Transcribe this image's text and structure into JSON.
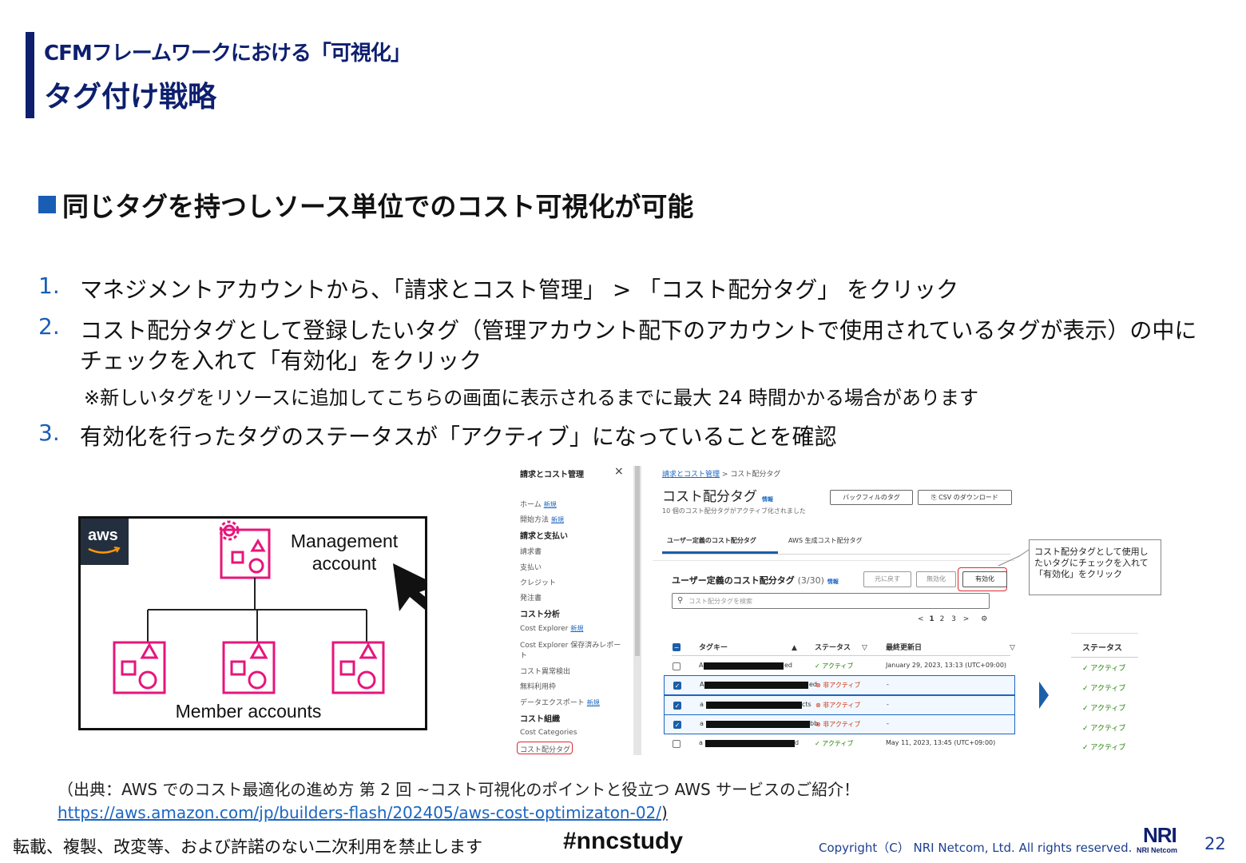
{
  "header": {
    "subtitle": "CFMフレームワークにおける「可視化」",
    "title": "タグ付け戦略"
  },
  "section": {
    "heading": "同じタグを持つしソース単位でのコスト可視化が可能"
  },
  "steps": [
    {
      "num": "1.",
      "line1": "マネジメントアカウントから、「請求とコスト管理」 > 「コスト配分タグ」 をクリック",
      "line2": ""
    },
    {
      "num": "2.",
      "line1": "コスト配分タグとして登録したいタグ（管理アカウント配下のアカウントで使用されているタグが表示）の中に",
      "line2": "チェックを入れて「有効化」をクリック"
    },
    {
      "num": "3.",
      "line1": "有効化を行ったタグのステータスが「アクティブ」になっていることを確認",
      "line2": ""
    }
  ],
  "note": "※新しいタグをリソースに追加してこちらの画面に表示されるまでに最大 24 時間かかる場合があります",
  "diagram": {
    "logo_text": "aws",
    "management_label_1": "Management",
    "management_label_2": "account",
    "member_label": "Member accounts",
    "accent_color": "#e7157b"
  },
  "console": {
    "sidebar": {
      "title": "請求とコスト管理",
      "close": "×",
      "new_badge": "新規",
      "items": [
        {
          "label": "ホーム",
          "bold": false,
          "new": true
        },
        {
          "label": "開始方法",
          "bold": false,
          "new": true
        },
        {
          "label": "請求と支払い",
          "bold": true,
          "new": false
        },
        {
          "label": "請求書",
          "bold": false,
          "new": false
        },
        {
          "label": "支払い",
          "bold": false,
          "new": false
        },
        {
          "label": "クレジット",
          "bold": false,
          "new": false
        },
        {
          "label": "発注書",
          "bold": false,
          "new": false
        },
        {
          "label": "コスト分析",
          "bold": true,
          "new": false
        },
        {
          "label": "Cost Explorer",
          "bold": false,
          "new": true
        },
        {
          "label": "Cost Explorer 保存済みレポー",
          "bold": false,
          "new": false
        },
        {
          "label": "ト",
          "bold": false,
          "new": false
        },
        {
          "label": "コスト異常検出",
          "bold": false,
          "new": false
        },
        {
          "label": "無料利用枠",
          "bold": false,
          "new": false
        },
        {
          "label": "データエクスポート",
          "bold": false,
          "new": true
        },
        {
          "label": "コスト組織",
          "bold": true,
          "new": false
        },
        {
          "label": "Cost Categories",
          "bold": false,
          "new": false
        },
        {
          "label": "コスト配分タグ",
          "bold": false,
          "new": false
        }
      ]
    },
    "breadcrumb_link": "請求とコスト管理",
    "breadcrumb_sep": ">",
    "breadcrumb_current": "コスト配分タグ",
    "page_title": "コスト配分タグ",
    "info": "情報",
    "page_subtitle": "10 個のコスト配分タグがアクティブ化されました",
    "backfill_button": "バックフィルのタグ",
    "csv_button": "CSV のダウンロード",
    "tab_user": "ユーザー定義のコスト配分タグ",
    "tab_aws": "AWS 生成コスト配分タグ",
    "panel_title": "ユーザー定義のコスト配分タグ",
    "panel_count": "(3/30)",
    "btn_restore": "元に戻す",
    "btn_disable": "無効化",
    "btn_enable": "有効化",
    "search_placeholder": "コスト配分タグを検索",
    "pager": {
      "prev": "<",
      "p1": "1",
      "p2": "2",
      "p3": "3",
      "next": ">",
      "gear": "⚙"
    },
    "columns": {
      "tag": "タグキー",
      "status": "ステータス",
      "updated": "最終更新日"
    },
    "rows": [
      {
        "prefix": "A",
        "suffix": "ed",
        "checked": false,
        "status": "アクティブ",
        "active": true,
        "date": "January 29, 2023, 13:13 (UTC+09:00)"
      },
      {
        "prefix": "A",
        "suffix": "ed",
        "checked": true,
        "status": "非アクティブ",
        "active": false,
        "date": "-"
      },
      {
        "prefix": "a",
        "suffix": "cts",
        "checked": true,
        "status": "非アクティブ",
        "active": false,
        "date": "-"
      },
      {
        "prefix": "a",
        "suffix": "bb",
        "checked": true,
        "status": "非アクティブ",
        "active": false,
        "date": "-"
      },
      {
        "prefix": "a",
        "suffix": "d",
        "checked": false,
        "status": "アクティブ",
        "active": true,
        "date": "May 11, 2023, 13:45 (UTC+09:00)"
      }
    ]
  },
  "callout": "コスト配分タグとして使用したいタグにチェックを入れて「有効化」をクリック",
  "result": {
    "header": "ステータス",
    "values": [
      "アクティブ",
      "アクティブ",
      "アクティブ",
      "アクティブ",
      "アクティブ"
    ]
  },
  "source": "（出典：AWS でのコスト最適化の進め方 第 2 回 ~コスト可視化のポイントと役立つ AWS サービスのご紹介！",
  "source_url": "https://aws.amazon.com/jp/builders-flash/202405/aws-cost-optimizaton-02/",
  "source_close": ")",
  "footer": {
    "notice": "転載、複製、改変等、および許諾のない二次利用を禁止します",
    "hashtag": "#nncstudy",
    "copyright": "Copyright（C） NRI Netcom, Ltd. All rights reserved.",
    "logo_big": "NRI",
    "logo_small": "NRI Netcom",
    "page": "22"
  },
  "colors": {
    "navy": "#0d1f6e",
    "blue": "#1a5db5",
    "pink": "#e7157b",
    "red": "#e0282e"
  }
}
